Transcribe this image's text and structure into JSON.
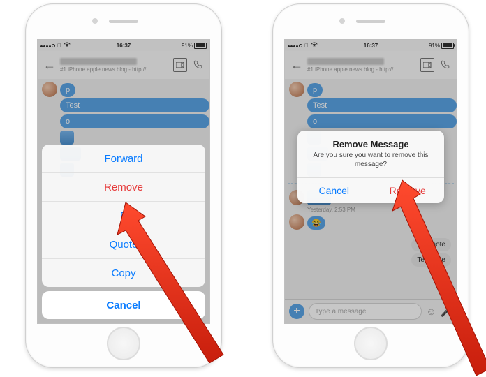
{
  "status": {
    "time": "16:37",
    "battery_pct": "91%"
  },
  "header": {
    "subtitle": "#1 iPhone apple news blog - http://..."
  },
  "messages": {
    "p": "p",
    "test": "Test",
    "o": "o",
    "test_note_1": "Test note",
    "test_note_2": "Test note",
    "incoming_time": "Yesterday, 2:53 PM"
  },
  "input": {
    "placeholder": "Type a message"
  },
  "sheet": {
    "forward": "Forward",
    "remove": "Remove",
    "edit_partial": "E",
    "quote": "Quote",
    "copy": "Copy",
    "cancel": "Cancel"
  },
  "alert": {
    "title": "Remove Message",
    "message": "Are you sure you want to remove this message?",
    "cancel": "Cancel",
    "remove": "Remove"
  }
}
